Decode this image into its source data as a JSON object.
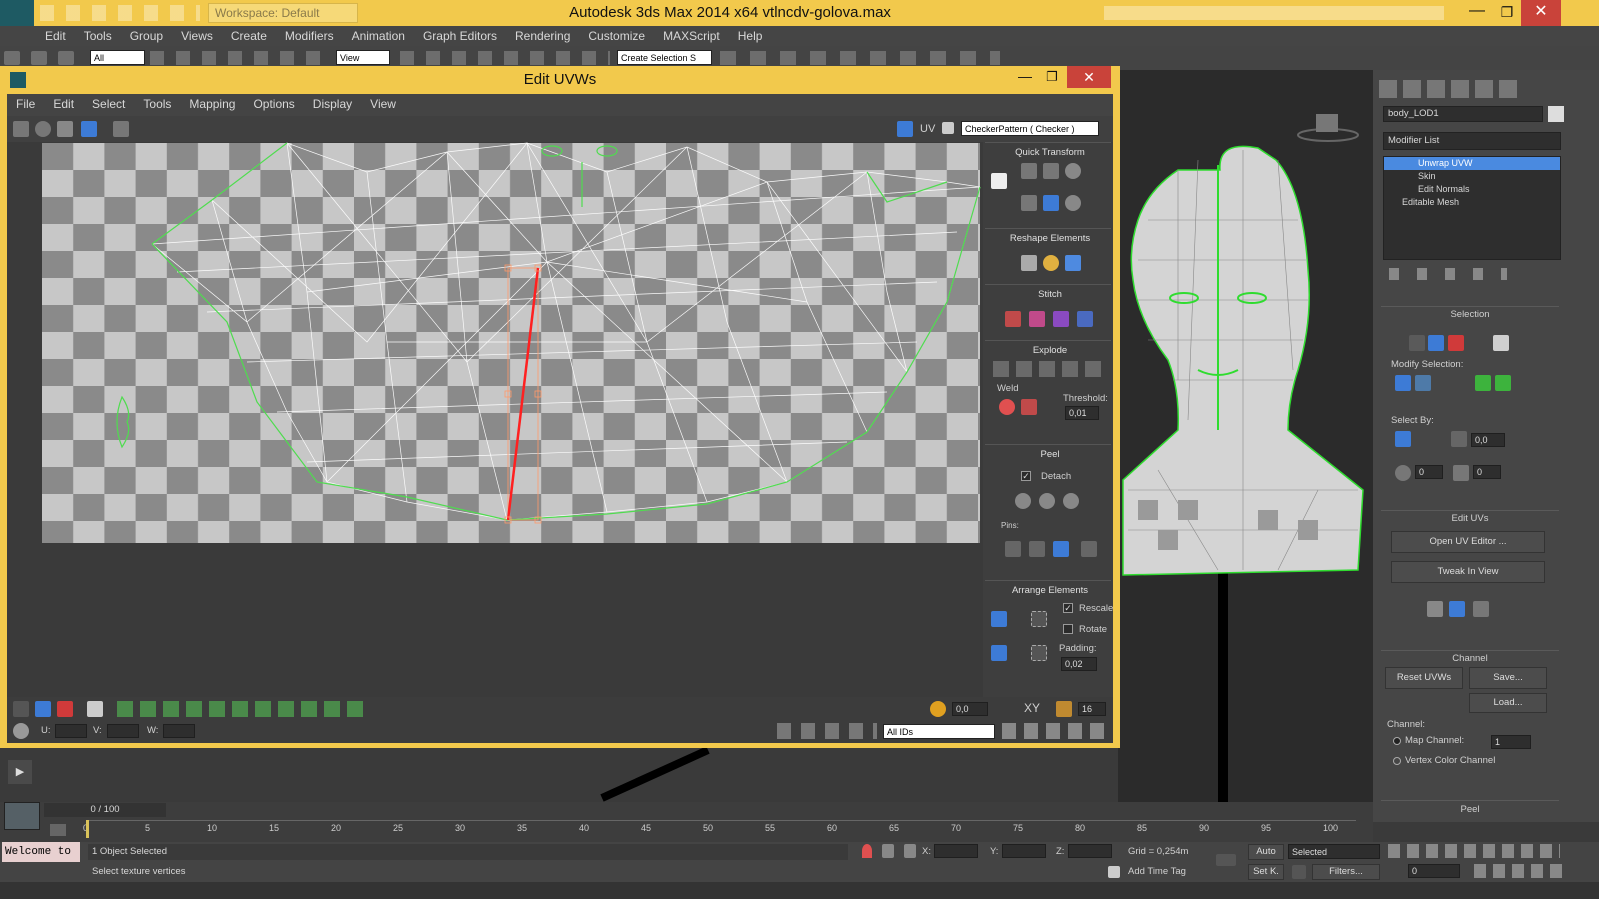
{
  "app": {
    "workspace_label": "Workspace: Default",
    "title": "Autodesk 3ds Max  2014 x64      vtlncdv-golova.max",
    "menu": [
      "Edit",
      "Tools",
      "Group",
      "Views",
      "Create",
      "Modifiers",
      "Animation",
      "Graph Editors",
      "Rendering",
      "Customize",
      "MAXScript",
      "Help"
    ],
    "toolbar": {
      "filter_value": "All",
      "refcoord_value": "View",
      "selset_placeholder": "Create Selection S"
    }
  },
  "uv_editor": {
    "title": "Edit UVWs",
    "menu": [
      "File",
      "Edit",
      "Select",
      "Tools",
      "Mapping",
      "Options",
      "Display",
      "View"
    ],
    "uv_label": "UV",
    "texture_dropdown": "CheckerPattern  ( Checker )",
    "panel": {
      "quick_transform": "Quick Transform",
      "reshape_elements": "Reshape Elements",
      "stitch": "Stitch",
      "explode": "Explode",
      "weld": "Weld",
      "threshold_label": "Threshold:",
      "threshold_value": "0,01",
      "peel": "Peel",
      "detach_label": "Detach",
      "pins_label": "Pins:",
      "arrange_elements": "Arrange Elements",
      "rescale_label": "Rescale",
      "rotate_label": "Rotate",
      "padding_label": "Padding:",
      "padding_value": "0,02"
    },
    "bottom": {
      "soft_value": "0,0",
      "xy_label": "XY",
      "zoom_value": "16",
      "u_label": "U:",
      "v_label": "V:",
      "w_label": "W:",
      "ids_value": "All IDs"
    }
  },
  "command_panel": {
    "object_name": "body_LOD1",
    "modifier_list_label": "Modifier List",
    "stack": [
      "Unwrap UVW",
      "Skin",
      "Edit Normals",
      "Editable Mesh"
    ],
    "selection_title": "Selection",
    "modify_selection_label": "Modify Selection:",
    "select_by_label": "Select By:",
    "select_by_value": "0,0",
    "spin_a": "0",
    "spin_b": "0",
    "edit_uvs_title": "Edit UVs",
    "open_uv_editor": "Open UV Editor ...",
    "tweak_in_view": "Tweak In View",
    "channel_title": "Channel",
    "reset_uvws": "Reset UVWs",
    "save": "Save...",
    "load": "Load...",
    "channel_label": "Channel:",
    "map_channel": "Map Channel:",
    "map_channel_value": "1",
    "vertex_color_channel": "Vertex Color Channel",
    "peel_title": "Peel"
  },
  "timeline": {
    "frame_counter": "0 / 100",
    "ticks": [
      "0",
      "5",
      "10",
      "15",
      "20",
      "25",
      "30",
      "35",
      "40",
      "45",
      "50",
      "55",
      "60",
      "65",
      "70",
      "75",
      "80",
      "85",
      "90",
      "95",
      "100"
    ]
  },
  "status": {
    "welcome": "Welcome to",
    "selected_count": "1 Object Selected",
    "prompt": "Select texture vertices",
    "x_label": "X:",
    "y_label": "Y:",
    "z_label": "Z:",
    "grid": "Grid = 0,254m",
    "add_time_tag": "Add Time Tag",
    "auto": "Auto",
    "set_key": "Set K.",
    "selected_dropdown": "Selected",
    "filters": "Filters...",
    "current_frame": "0"
  },
  "colors": {
    "title_accent": "#f2c94c",
    "uv_edge": "#ffffff",
    "uv_border": "#4fdc4f",
    "selected_edge": "#ff2020",
    "stack_highlight": "#4a8ae0"
  }
}
